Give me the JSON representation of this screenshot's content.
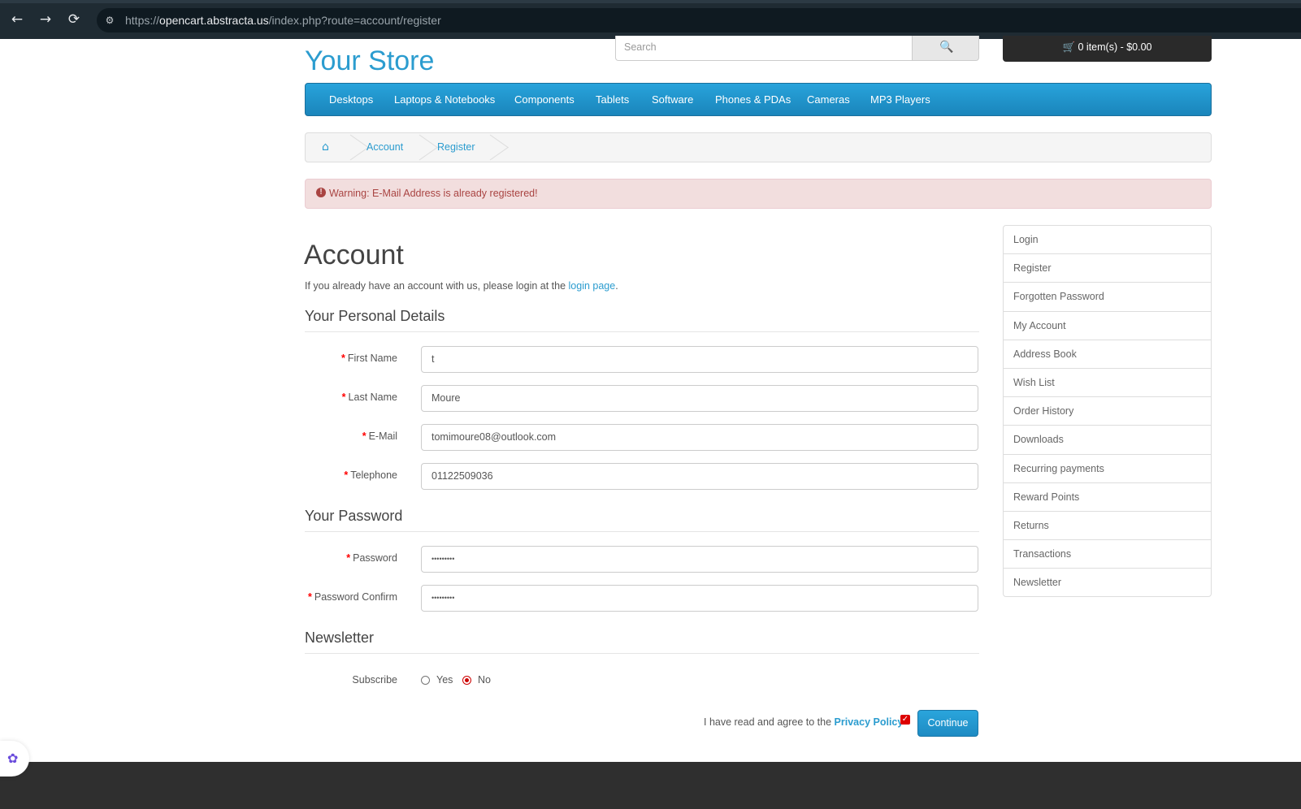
{
  "browser": {
    "back_icon": "←",
    "forward_icon": "→",
    "reload_icon": "⟳",
    "site_icon": "⚙",
    "url_prefix": "https://",
    "url_domain": "opencart.abstracta.us",
    "url_path": "/index.php?route=account/register"
  },
  "header": {
    "logo": "Your Store",
    "search_placeholder": "Search",
    "search_icon": "🔍",
    "cart": "🛒 0 item(s) - $0.00"
  },
  "menu": [
    "Desktops",
    "Laptops & Notebooks",
    "Components",
    "Tablets",
    "Software",
    "Phones & PDAs",
    "Cameras",
    "MP3 Players"
  ],
  "breadcrumb": {
    "home_icon": "⌂",
    "items": [
      "Account",
      "Register"
    ]
  },
  "alert": {
    "icon": "!",
    "text": "Warning: E-Mail Address is already registered!"
  },
  "main": {
    "title": "Account",
    "intro_text": "If you already have an account with us, please login at the ",
    "intro_link": "login page",
    "intro_end": ".",
    "personal_legend": "Your Personal Details",
    "password_legend": "Your Password",
    "newsletter_legend": "Newsletter",
    "fields": {
      "first_name": {
        "label": "First Name",
        "value": "t"
      },
      "last_name": {
        "label": "Last Name",
        "value": "Moure"
      },
      "email": {
        "label": "E-Mail",
        "value": "tomimoure08@outlook.com"
      },
      "telephone": {
        "label": "Telephone",
        "value": "01122509036"
      },
      "password": {
        "label": "Password",
        "value": "•••••••••"
      },
      "password_confirm": {
        "label": "Password Confirm",
        "value": "•••••••••"
      }
    },
    "required_mark": "*",
    "subscribe_label": "Subscribe",
    "subscribe_yes": "Yes",
    "subscribe_no": "No",
    "agree_text": "I have read and agree to the ",
    "privacy_link": "Privacy Policy",
    "agree_check": "✓",
    "continue_label": "Continue"
  },
  "sidebar": [
    "Login",
    "Register",
    "Forgotten Password",
    "My Account",
    "Address Book",
    "Wish List",
    "Order History",
    "Downloads",
    "Recurring payments",
    "Reward Points",
    "Returns",
    "Transactions",
    "Newsletter"
  ],
  "extension_icon": "✿"
}
